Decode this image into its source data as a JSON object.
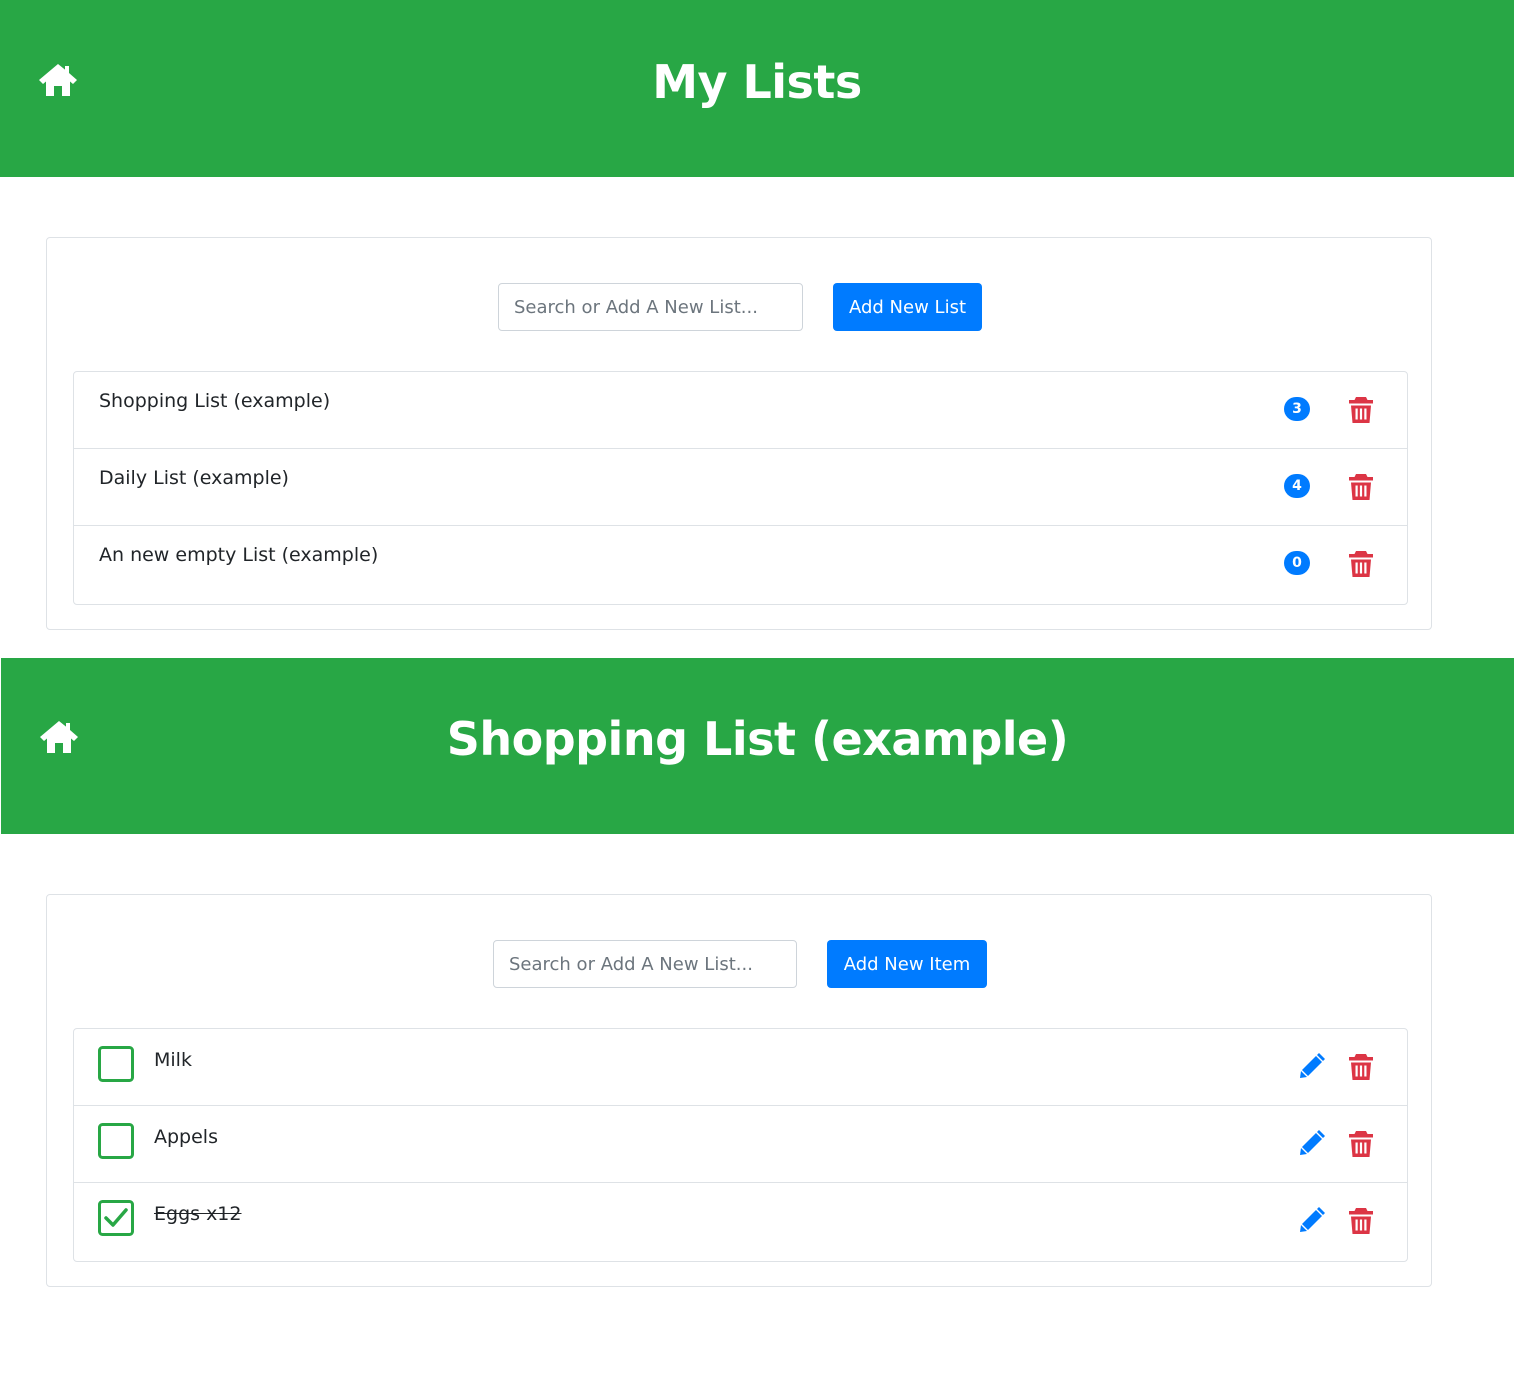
{
  "colors": {
    "header_green": "#28a745",
    "primary_blue": "#007bff",
    "danger_red": "#dc3545",
    "border": "#dee2e6"
  },
  "lists_view": {
    "title": "My Lists",
    "search_placeholder": "Search or Add A New List...",
    "add_button_label": "Add New List",
    "lists": [
      {
        "name": "Shopping List (example)",
        "count": "3"
      },
      {
        "name": "Daily List (example)",
        "count": "4"
      },
      {
        "name": "An new empty List (example)",
        "count": "0"
      }
    ]
  },
  "list_detail_view": {
    "title": "Shopping List (example)",
    "search_placeholder": "Search or Add A New List...",
    "add_button_label": "Add New Item",
    "items": [
      {
        "label": "Milk",
        "checked": false
      },
      {
        "label": "Appels",
        "checked": false
      },
      {
        "label": "Eggs x12",
        "checked": true
      }
    ]
  },
  "icons": {
    "home": "home-icon",
    "trash": "trash-icon",
    "edit": "pencil-icon",
    "check": "check-icon"
  }
}
